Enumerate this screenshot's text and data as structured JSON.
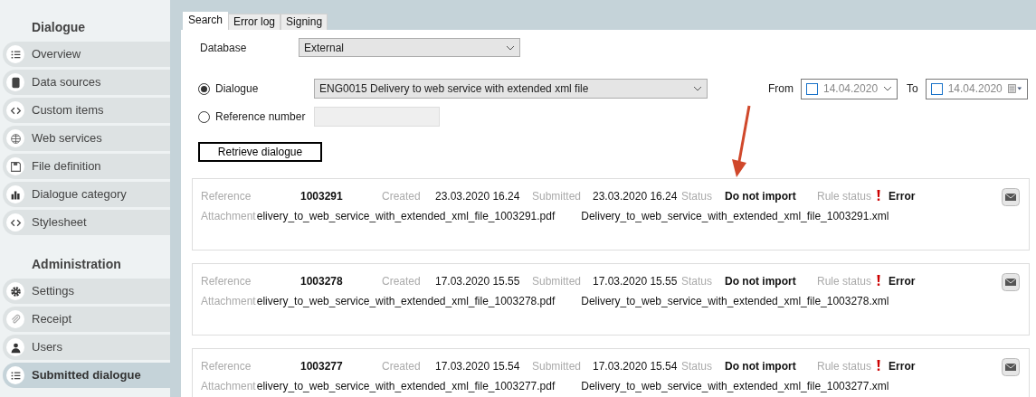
{
  "sidebar": {
    "sections": [
      {
        "title": "Dialogue",
        "items": [
          {
            "label": "Overview",
            "selected": false
          },
          {
            "label": "Data sources",
            "selected": false
          },
          {
            "label": "Custom items",
            "selected": false
          },
          {
            "label": "Web services",
            "selected": false
          },
          {
            "label": "File definition",
            "selected": false
          },
          {
            "label": "Dialogue category",
            "selected": false
          },
          {
            "label": "Stylesheet",
            "selected": false
          }
        ]
      },
      {
        "title": "Administration",
        "items": [
          {
            "label": "Settings",
            "selected": false
          },
          {
            "label": "Receipt",
            "selected": false
          },
          {
            "label": "Users",
            "selected": false
          },
          {
            "label": "Submitted dialogue",
            "selected": true
          }
        ]
      }
    ]
  },
  "tabs": [
    {
      "label": "Search",
      "selected": true
    },
    {
      "label": "Error log",
      "selected": false
    },
    {
      "label": "Signing",
      "selected": false
    }
  ],
  "search": {
    "database": {
      "label": "Database",
      "value": "External"
    },
    "radios": [
      {
        "label": "Dialogue",
        "selected": true
      },
      {
        "label": "Reference number",
        "selected": false
      }
    ],
    "dialogue_value": "ENG0015 Delivery to web service with extended xml file",
    "from": {
      "label": "From",
      "date": "14.04.2020",
      "checked": false
    },
    "to": {
      "label": "To",
      "date": "14.04.2020",
      "checked": false
    },
    "button": "Retrieve dialogue"
  },
  "records": [
    {
      "fields": [
        {
          "label": "Reference",
          "value": "1003291"
        },
        {
          "label": "Created",
          "value": "23.03.2020 16.24"
        },
        {
          "label": "Submitted",
          "value": "23.03.2020 16.24"
        },
        {
          "label": "Status",
          "value": "Do not import"
        },
        {
          "label": "Rule status",
          "value": "Error"
        }
      ],
      "attachment_label": "Attachment",
      "attachments": [
        "elivery_to_web_service_with_extended_xml_file_1003291.pdf",
        "Delivery_to_web_service_with_extended_xml_file_1003291.xml"
      ]
    },
    {
      "fields": [
        {
          "label": "Reference",
          "value": "1003278"
        },
        {
          "label": "Created",
          "value": "17.03.2020 15.55"
        },
        {
          "label": "Submitted",
          "value": "17.03.2020 15.55"
        },
        {
          "label": "Status",
          "value": "Do not import"
        },
        {
          "label": "Rule status",
          "value": "Error"
        }
      ],
      "attachment_label": "Attachment",
      "attachments": [
        "elivery_to_web_service_with_extended_xml_file_1003278.pdf",
        "Delivery_to_web_service_with_extended_xml_file_1003278.xml"
      ]
    },
    {
      "fields": [
        {
          "label": "Reference",
          "value": "1003277"
        },
        {
          "label": "Created",
          "value": "17.03.2020 15.54"
        },
        {
          "label": "Submitted",
          "value": "17.03.2020 15.54"
        },
        {
          "label": "Status",
          "value": "Do not import"
        },
        {
          "label": "Rule status",
          "value": "Error"
        }
      ],
      "attachment_label": "Attachment",
      "attachments": [
        "elivery_to_web_service_with_extended_xml_file_1003277.pdf",
        "Delivery_to_web_service_with_extended_xml_file_1003277.xml"
      ]
    }
  ]
}
